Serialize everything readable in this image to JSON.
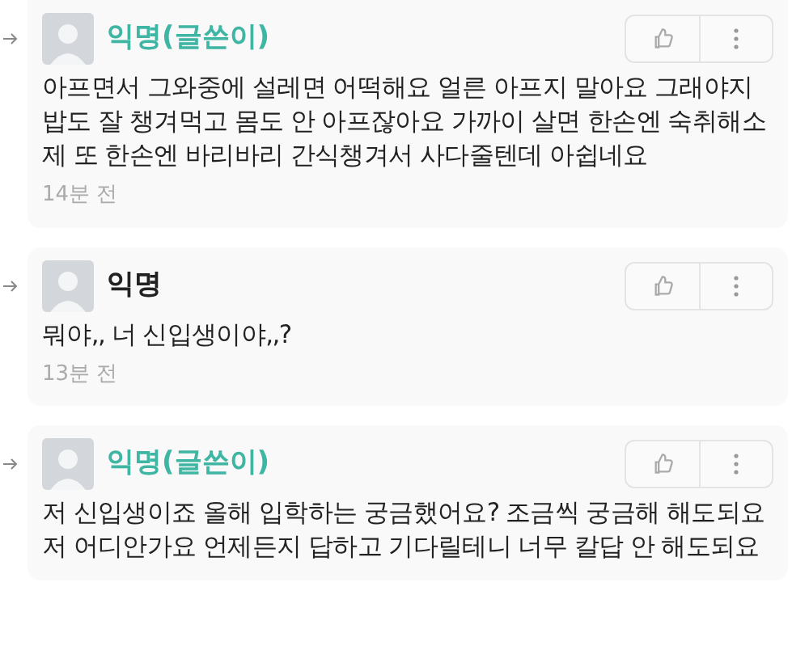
{
  "comments": [
    {
      "kind": "author",
      "name": "익명(글쓴이)",
      "body": "아프면서 그와중에 설레면 어떡해요 얼른 아프지 말아요 그래야지 밥도 잘 챙겨먹고 몸도 안 아프잖아요 가까이 살면 한손엔 숙취해소제 또 한손엔 바리바리 간식챙겨서 사다줄텐데 아쉽네요",
      "time": "14분 전"
    },
    {
      "kind": "other",
      "name": "익명",
      "body": "뭐야,, 너 신입생이야,,?",
      "time": "13분 전"
    },
    {
      "kind": "author",
      "name": "익명(글쓴이)",
      "body": "저 신입생이죠 올해 입학하는  궁금했어요? 조금씩 궁금해 해도되요 저 어디안가요 언제든지 답하고 기다릴테니 너무 칼답 안 해도되요"
    }
  ]
}
